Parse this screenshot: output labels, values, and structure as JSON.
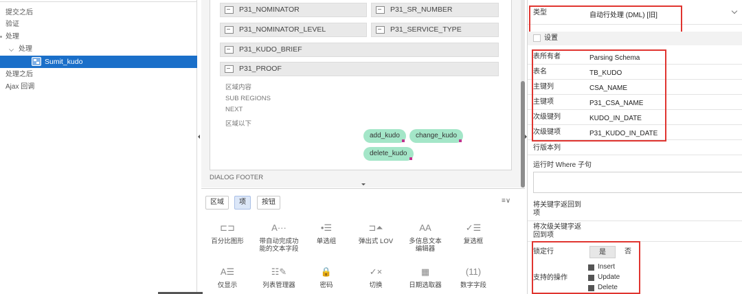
{
  "tree": {
    "nodes": [
      "提交之后",
      "验证",
      "处理",
      "处理",
      "处理之后",
      "Ajax 回调"
    ],
    "selected": "Sumit_kudo"
  },
  "canvas": {
    "items": [
      "P31_NOMINATOR",
      "P31_SR_NUMBER",
      "P31_NOMINATOR_LEVEL",
      "P31_SERVICE_TYPE",
      "P31_KUDO_BRIEF",
      "P31_PROOF"
    ],
    "region_labels": [
      "区域内容",
      "SUB REGIONS",
      "NEXT",
      "区域以下"
    ],
    "buttons": [
      "add_kudo",
      "change_kudo",
      "delete_kudo"
    ],
    "dialog_footer": "DIALOG FOOTER"
  },
  "palette": {
    "tabs": [
      "区域",
      "项",
      "按钮"
    ],
    "active_tab": "项",
    "menu_icon": "≡∨",
    "items": [
      {
        "label": "百分比图形",
        "glyph": "⊏⊐"
      },
      {
        "label": "带自动完成功能的文本字段",
        "glyph": "A···"
      },
      {
        "label": "单选组",
        "glyph": "•☰"
      },
      {
        "label": "弹出式 LOV",
        "glyph": "⊐⏶"
      },
      {
        "label": "多信息文本编辑器",
        "glyph": "AA"
      },
      {
        "label": "复选框",
        "glyph": "✓☰"
      },
      {
        "label": "仅显示",
        "glyph": "A☰"
      },
      {
        "label": "列表管理器",
        "glyph": "☷✎"
      },
      {
        "label": "密码",
        "glyph": "🔒"
      },
      {
        "label": "切换",
        "glyph": "✓×"
      },
      {
        "label": "日期选取器",
        "glyph": "▦"
      },
      {
        "label": "数字字段",
        "glyph": "(11)"
      }
    ]
  },
  "props": {
    "type_label": "类型",
    "type_value": "自动行处理 (DML) [旧]",
    "settings_label": "设置",
    "rows": [
      {
        "label": "表所有者",
        "value": "Parsing Schema"
      },
      {
        "label": "表名",
        "value": "TB_KUDO"
      },
      {
        "label": "主键列",
        "value": "CSA_NAME"
      },
      {
        "label": "主键项",
        "value": "P31_CSA_NAME"
      },
      {
        "label": "次级键列",
        "value": "KUDO_IN_DATE"
      },
      {
        "label": "次级键项",
        "value": "P31_KUDO_IN_DATE"
      }
    ],
    "row_version_label": "行版本列",
    "where_label": "运行时 Where 子句",
    "return_pk_label": "将关键字返回到项",
    "return_sk_label": "将次级关键字返回到项",
    "lock_label": "锁定行",
    "lock_yes": "是",
    "lock_no": "否",
    "ops_label": "支持的操作",
    "ops": [
      "Insert",
      "Update",
      "Delete"
    ]
  }
}
